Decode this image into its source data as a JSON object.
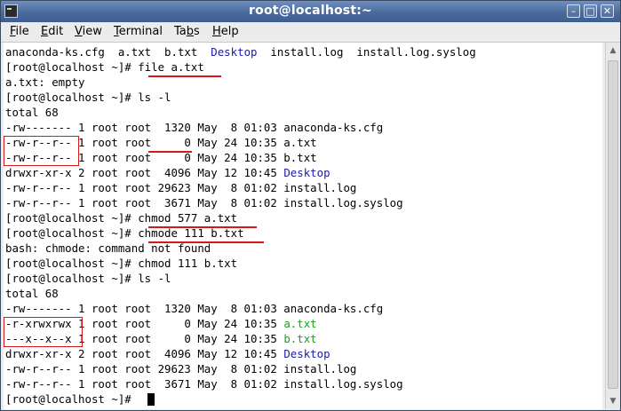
{
  "window": {
    "title": "root@localhost:~",
    "buttons": {
      "minimize": "–",
      "maximize": "□",
      "close": "✕"
    }
  },
  "menu": {
    "items": [
      {
        "label": "File",
        "u": "F",
        "rest": "ile"
      },
      {
        "label": "Edit",
        "u": "E",
        "rest": "dit"
      },
      {
        "label": "View",
        "u": "V",
        "rest": "iew"
      },
      {
        "label": "Terminal",
        "u": "T",
        "rest": "erminal"
      },
      {
        "label": "Tabs",
        "pre": "Ta",
        "u": "b",
        "rest": "s"
      },
      {
        "label": "Help",
        "u": "H",
        "rest": "elp"
      }
    ]
  },
  "terminal": {
    "lines": [
      {
        "segments": [
          {
            "t": "anaconda-ks.cfg  a.txt  b.txt  "
          },
          {
            "t": "Desktop",
            "c": "blue"
          },
          {
            "t": "  install.log  install.log.syslog"
          }
        ]
      },
      {
        "segments": [
          {
            "t": "[root@localhost ~]# file a.txt"
          }
        ]
      },
      {
        "segments": [
          {
            "t": "a.txt: empty"
          }
        ]
      },
      {
        "segments": [
          {
            "t": "[root@localhost ~]# ls -l"
          }
        ]
      },
      {
        "segments": [
          {
            "t": "total 68"
          }
        ]
      },
      {
        "segments": [
          {
            "t": "-rw------- 1 root root  1320 May  8 01:03 anaconda-ks.cfg"
          }
        ]
      },
      {
        "segments": [
          {
            "t": "-rw-r--r-- 1 root root     0 May 24 10:35 a.txt"
          }
        ]
      },
      {
        "segments": [
          {
            "t": "-rw-r--r-- 1 root root     0 May 24 10:35 b.txt"
          }
        ]
      },
      {
        "segments": [
          {
            "t": "drwxr-xr-x 2 root root  4096 May 12 10:45 "
          },
          {
            "t": "Desktop",
            "c": "blue"
          }
        ]
      },
      {
        "segments": [
          {
            "t": "-rw-r--r-- 1 root root 29623 May  8 01:02 install.log"
          }
        ]
      },
      {
        "segments": [
          {
            "t": "-rw-r--r-- 1 root root  3671 May  8 01:02 install.log.syslog"
          }
        ]
      },
      {
        "segments": [
          {
            "t": "[root@localhost ~]# chmod 577 a.txt"
          }
        ]
      },
      {
        "segments": [
          {
            "t": "[root@localhost ~]# chmode 111 b.txt"
          }
        ]
      },
      {
        "segments": [
          {
            "t": "bash: chmode: command not found"
          }
        ]
      },
      {
        "segments": [
          {
            "t": "[root@localhost ~]# chmod 111 b.txt"
          }
        ]
      },
      {
        "segments": [
          {
            "t": "[root@localhost ~]# ls -l"
          }
        ]
      },
      {
        "segments": [
          {
            "t": "total 68"
          }
        ]
      },
      {
        "segments": [
          {
            "t": "-rw------- 1 root root  1320 May  8 01:03 anaconda-ks.cfg"
          }
        ]
      },
      {
        "segments": [
          {
            "t": "-r-xrwxrwx 1 root root     0 May 24 10:35 "
          },
          {
            "t": "a.txt",
            "c": "green"
          }
        ]
      },
      {
        "segments": [
          {
            "t": "---x--x--x 1 root root     0 May 24 10:35 "
          },
          {
            "t": "b.txt",
            "c": "green"
          }
        ]
      },
      {
        "segments": [
          {
            "t": "drwxr-xr-x 2 root root  4096 May 12 10:45 "
          },
          {
            "t": "Desktop",
            "c": "blue"
          }
        ]
      },
      {
        "segments": [
          {
            "t": "-rw-r--r-- 1 root root 29623 May  8 01:02 install.log"
          }
        ]
      },
      {
        "segments": [
          {
            "t": "-rw-r--r-- 1 root root  3671 May  8 01:02 install.log.syslog"
          }
        ]
      },
      {
        "segments": [
          {
            "t": "[root@localhost ~]# "
          }
        ]
      }
    ]
  },
  "colors": {
    "directory": "#1a1aa6",
    "executable": "#1aa11a",
    "annotation": "#d11a1a"
  }
}
